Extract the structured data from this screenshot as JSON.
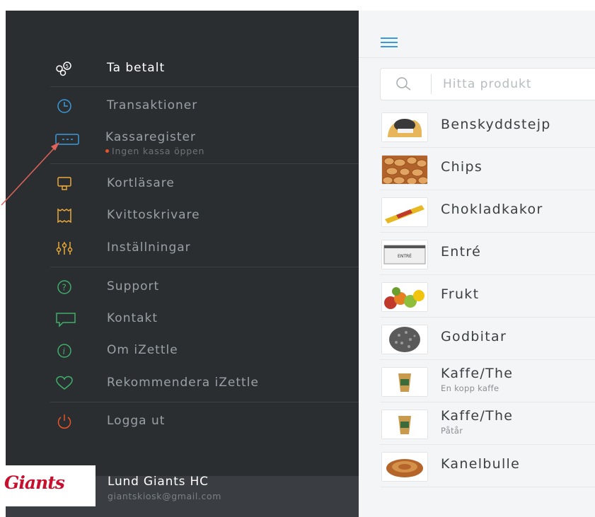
{
  "sidebar": {
    "items": [
      {
        "label": "Ta betalt",
        "icon": "coins-icon"
      },
      {
        "label": "Transaktioner",
        "icon": "clock-icon"
      },
      {
        "label": "Kassaregister",
        "icon": "cash-register-icon",
        "sublabel": "Ingen kassa öppen"
      },
      {
        "label": "Kortläsare",
        "icon": "card-reader-icon"
      },
      {
        "label": "Kvittoskrivare",
        "icon": "receipt-printer-icon"
      },
      {
        "label": "Inställningar",
        "icon": "sliders-icon"
      },
      {
        "label": "Support",
        "icon": "question-icon"
      },
      {
        "label": "Kontakt",
        "icon": "chat-icon"
      },
      {
        "label": "Om iZettle",
        "icon": "info-icon"
      },
      {
        "label": "Rekommendera iZettle",
        "icon": "heart-icon"
      },
      {
        "label": "Logga ut",
        "icon": "power-icon"
      }
    ],
    "account": {
      "logo_text": "Giants",
      "name": "Lund Giants HC",
      "email": "giantskiosk@gmail.com"
    }
  },
  "colors": {
    "sidebar_bg": "#2b2e31",
    "accent_blue": "#3a9ad9",
    "accent_yellow": "#e9a93a",
    "accent_green": "#3fae6a",
    "accent_red": "#e8542a",
    "annotation_arrow": "#e0625a"
  },
  "main": {
    "search": {
      "placeholder": "Hitta produkt",
      "icon": "search-icon"
    },
    "products": [
      {
        "name": "Benskyddstejp",
        "sub": ""
      },
      {
        "name": "Chips",
        "sub": ""
      },
      {
        "name": "Chokladkakor",
        "sub": ""
      },
      {
        "name": "Entré",
        "sub": "",
        "thumb_text": "ENTRÉ"
      },
      {
        "name": "Frukt",
        "sub": ""
      },
      {
        "name": "Godbitar",
        "sub": ""
      },
      {
        "name": "Kaffe/The",
        "sub": "En kopp kaffe"
      },
      {
        "name": "Kaffe/The",
        "sub": "Påtår"
      },
      {
        "name": "Kanelbulle",
        "sub": ""
      }
    ]
  }
}
